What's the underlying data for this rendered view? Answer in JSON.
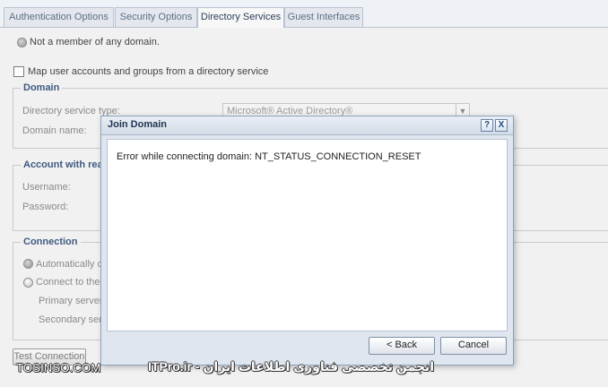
{
  "tabs": [
    {
      "label": "Authentication Options",
      "active": false
    },
    {
      "label": "Security Options",
      "active": false
    },
    {
      "label": "Directory Services",
      "active": true
    },
    {
      "label": "Guest Interfaces",
      "active": false
    }
  ],
  "status": {
    "membership": "Not a member of any domain."
  },
  "map_checkbox": {
    "label": "Map user accounts and groups from a directory service",
    "checked": false
  },
  "domain_section": {
    "legend": "Domain",
    "type_label": "Directory service type:",
    "type_value": "Microsoft® Active Directory®",
    "name_label": "Domain name:"
  },
  "account_section": {
    "legend": "Account with read",
    "username_label": "Username:",
    "password_label": "Password:"
  },
  "connection_section": {
    "legend": "Connection",
    "auto_label": "Automatically co",
    "connect_label": "Connect to the s",
    "primary_label": "Primary server:",
    "secondary_label": "Secondary serve"
  },
  "test_button": {
    "label": "Test Connection"
  },
  "dialog": {
    "title": "Join Domain",
    "help_label": "?",
    "close_label": "X",
    "message": "Error while connecting domain: NT_STATUS_CONNECTION_RESET",
    "back_label": "< Back",
    "cancel_label": "Cancel"
  },
  "watermark": {
    "left": "TOSINSO.COM",
    "right": "ITPro.ir - انجمن تخصصی فناوری اطلاعات ایران"
  }
}
